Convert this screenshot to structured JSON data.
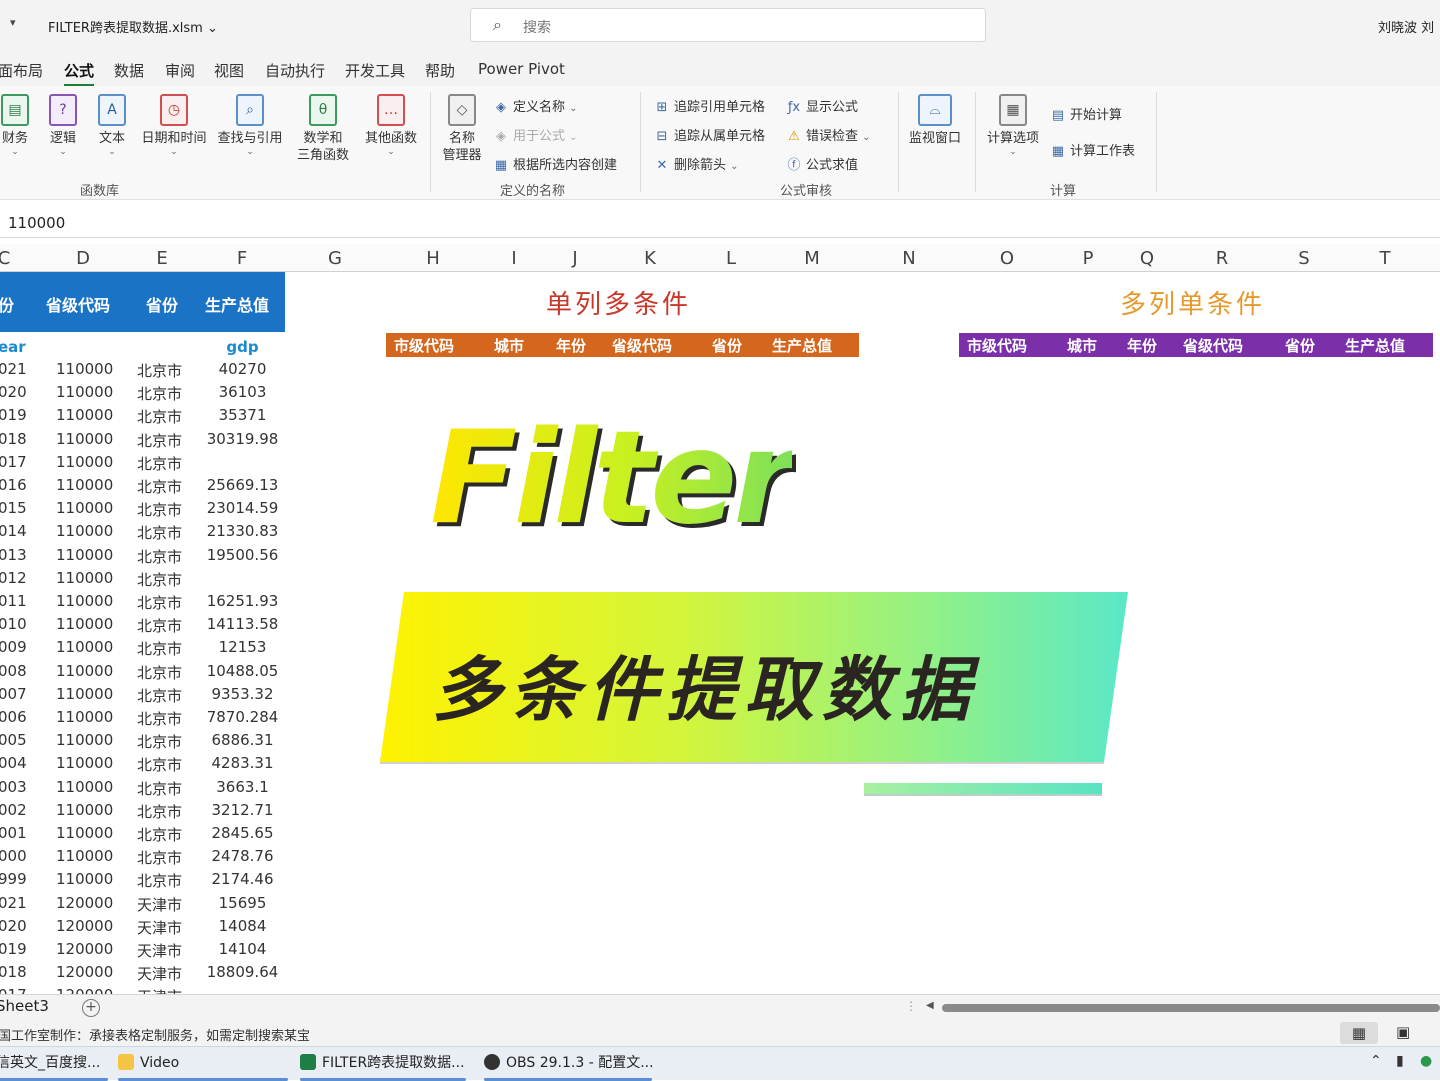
{
  "titlebar": {
    "filename": "FILTER跨表提取数据.xlsm ⌄",
    "search_placeholder": "搜索",
    "user": "刘晓波 刘"
  },
  "menu": [
    "面布局",
    "公式",
    "数据",
    "审阅",
    "视图",
    "自动执行",
    "开发工具",
    "帮助",
    "Power Pivot"
  ],
  "menu_active": "公式",
  "ribbon": {
    "func_library": {
      "buttons": [
        "财务",
        "逻辑",
        "文本",
        "日期和时间",
        "查找与引用",
        "数学和\n三角函数",
        "其他函数"
      ],
      "group": "函数库"
    },
    "defined_names": {
      "name_manager": "名称\n管理器",
      "define_name": "定义名称",
      "use_in_formula": "用于公式",
      "create_from_selection": "根据所选内容创建",
      "group": "定义的名称"
    },
    "auditing": {
      "trace_precedents": "追踪引用单元格",
      "trace_dependents": "追踪从属单元格",
      "remove_arrows": "删除箭头",
      "show_formulas": "显示公式",
      "error_checking": "错误检查",
      "evaluate": "公式求值",
      "group": "公式审核"
    },
    "watch_window": "监视窗口",
    "calculation": {
      "options": "计算选项",
      "calc_now": "开始计算",
      "calc_sheet": "计算工作表",
      "group": "计算"
    }
  },
  "formula_bar": {
    "value": "110000"
  },
  "columns": [
    "C",
    "D",
    "E",
    "F",
    "G",
    "H",
    "I",
    "J",
    "K",
    "L",
    "M",
    "N",
    "O",
    "P",
    "Q",
    "R",
    "S",
    "T"
  ],
  "table": {
    "header": [
      "份",
      "省级代码",
      "省份",
      "生产总值"
    ],
    "subheader": {
      "year": "ear",
      "gdp": "gdp"
    },
    "rows": [
      {
        "year": "021",
        "code": "110000",
        "prov": "北京市",
        "gdp": "40270"
      },
      {
        "year": "020",
        "code": "110000",
        "prov": "北京市",
        "gdp": "36103"
      },
      {
        "year": "019",
        "code": "110000",
        "prov": "北京市",
        "gdp": "35371"
      },
      {
        "year": "018",
        "code": "110000",
        "prov": "北京市",
        "gdp": "30319.98"
      },
      {
        "year": "017",
        "code": "110000",
        "prov": "北京市",
        "gdp": ""
      },
      {
        "year": "016",
        "code": "110000",
        "prov": "北京市",
        "gdp": "25669.13"
      },
      {
        "year": "015",
        "code": "110000",
        "prov": "北京市",
        "gdp": "23014.59"
      },
      {
        "year": "014",
        "code": "110000",
        "prov": "北京市",
        "gdp": "21330.83"
      },
      {
        "year": "013",
        "code": "110000",
        "prov": "北京市",
        "gdp": "19500.56"
      },
      {
        "year": "012",
        "code": "110000",
        "prov": "北京市",
        "gdp": ""
      },
      {
        "year": "011",
        "code": "110000",
        "prov": "北京市",
        "gdp": "16251.93"
      },
      {
        "year": "010",
        "code": "110000",
        "prov": "北京市",
        "gdp": "14113.58"
      },
      {
        "year": "009",
        "code": "110000",
        "prov": "北京市",
        "gdp": "12153"
      },
      {
        "year": "008",
        "code": "110000",
        "prov": "北京市",
        "gdp": "10488.05"
      },
      {
        "year": "007",
        "code": "110000",
        "prov": "北京市",
        "gdp": "9353.32"
      },
      {
        "year": "006",
        "code": "110000",
        "prov": "北京市",
        "gdp": "7870.284"
      },
      {
        "year": "005",
        "code": "110000",
        "prov": "北京市",
        "gdp": "6886.31"
      },
      {
        "year": "004",
        "code": "110000",
        "prov": "北京市",
        "gdp": "4283.31"
      },
      {
        "year": "003",
        "code": "110000",
        "prov": "北京市",
        "gdp": "3663.1"
      },
      {
        "year": "002",
        "code": "110000",
        "prov": "北京市",
        "gdp": "3212.71"
      },
      {
        "year": "001",
        "code": "110000",
        "prov": "北京市",
        "gdp": "2845.65"
      },
      {
        "year": "000",
        "code": "110000",
        "prov": "北京市",
        "gdp": "2478.76"
      },
      {
        "year": "999",
        "code": "110000",
        "prov": "北京市",
        "gdp": "2174.46"
      },
      {
        "year": "021",
        "code": "120000",
        "prov": "天津市",
        "gdp": "15695"
      },
      {
        "year": "020",
        "code": "120000",
        "prov": "天津市",
        "gdp": "14084"
      },
      {
        "year": "019",
        "code": "120000",
        "prov": "天津市",
        "gdp": "14104"
      },
      {
        "year": "018",
        "code": "120000",
        "prov": "天津市",
        "gdp": "18809.64"
      },
      {
        "year": "017",
        "code": "120000",
        "prov": "天津市",
        "gdp": ""
      }
    ]
  },
  "section1": {
    "title": "单列多条件",
    "color": "#c8382a",
    "strip_color": "#d4661e",
    "headers": [
      "市级代码",
      "城市",
      "年份",
      "省级代码",
      "省份",
      "生产总值"
    ]
  },
  "section2": {
    "title": "多列单条件",
    "color": "#e69a2e",
    "strip_color": "#7b2fa8",
    "headers": [
      "市级代码",
      "城市",
      "年份",
      "省级代码",
      "省份",
      "生产总值"
    ]
  },
  "overlay": {
    "filter_text": "Filter",
    "banner_text": "多条件提取数据"
  },
  "sheet_tab": "Sheet3",
  "status_message": "国工作室制作：承接表格定制服务，如需定制搜索某宝",
  "taskbar": {
    "items": [
      "信英文_百度搜...",
      "Video",
      "FILTER跨表提取数据...",
      "OBS 29.1.3 - 配置文..."
    ]
  }
}
